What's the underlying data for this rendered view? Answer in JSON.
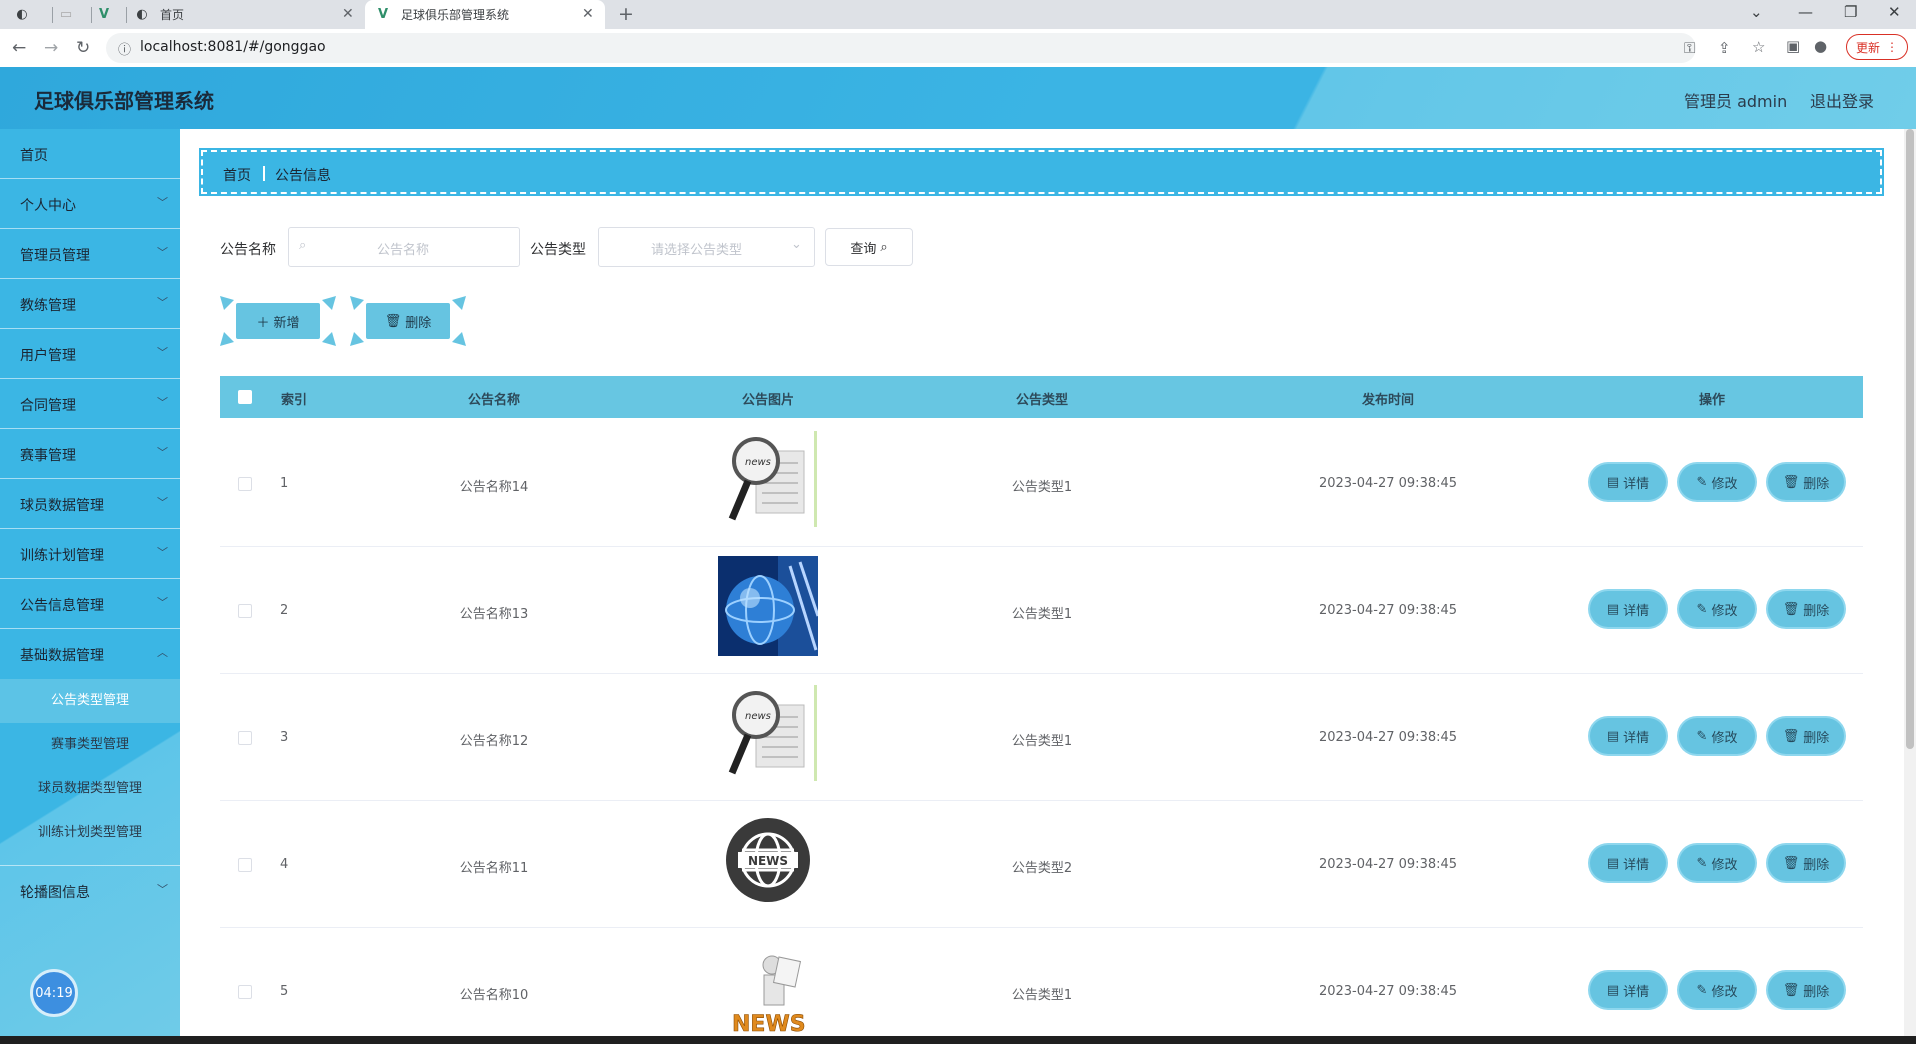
{
  "browser": {
    "tabs": [
      {
        "label": "首页"
      },
      {
        "label": "足球俱乐部管理系统"
      }
    ],
    "url": "localhost:8081/#/gonggao",
    "update_label": "更新"
  },
  "header": {
    "title": "足球俱乐部管理系统",
    "user": "管理员 admin",
    "logout": "退出登录"
  },
  "sidebar": {
    "items": [
      {
        "label": "首页"
      },
      {
        "label": "个人中心"
      },
      {
        "label": "管理员管理"
      },
      {
        "label": "教练管理"
      },
      {
        "label": "用户管理"
      },
      {
        "label": "合同管理"
      },
      {
        "label": "赛事管理"
      },
      {
        "label": "球员数据管理"
      },
      {
        "label": "训练计划管理"
      },
      {
        "label": "公告信息管理"
      },
      {
        "label": "基础数据管理"
      },
      {
        "label": "轮播图信息"
      }
    ],
    "sub_items": [
      {
        "label": "公告类型管理"
      },
      {
        "label": "赛事类型管理"
      },
      {
        "label": "球员数据类型管理"
      },
      {
        "label": "训练计划类型管理"
      }
    ],
    "clock": "04:19"
  },
  "breadcrumb": {
    "home": "首页",
    "current": "公告信息"
  },
  "filters": {
    "name_label": "公告名称",
    "name_placeholder": "公告名称",
    "type_label": "公告类型",
    "type_placeholder": "请选择公告类型",
    "query_label": "查询"
  },
  "actions": {
    "add_label": "新增",
    "delete_label": "删除"
  },
  "table": {
    "columns": [
      "索引",
      "公告名称",
      "公告图片",
      "公告类型",
      "发布时间",
      "操作"
    ],
    "row_buttons": {
      "detail": "详情",
      "edit": "修改",
      "delete": "删除"
    },
    "rows": [
      {
        "index": "1",
        "name": "公告名称14",
        "image": "news-magnifier-icon",
        "type": "公告类型1",
        "time": "2023-04-27 09:38:45"
      },
      {
        "index": "2",
        "name": "公告名称13",
        "image": "globe-news-icon",
        "type": "公告类型1",
        "time": "2023-04-27 09:38:45"
      },
      {
        "index": "3",
        "name": "公告名称12",
        "image": "news-magnifier-icon",
        "type": "公告类型1",
        "time": "2023-04-27 09:38:45"
      },
      {
        "index": "4",
        "name": "公告名称11",
        "image": "news-globe-badge-icon",
        "type": "公告类型2",
        "time": "2023-04-27 09:38:45"
      },
      {
        "index": "5",
        "name": "公告名称10",
        "image": "news-figure-icon",
        "type": "公告类型1",
        "time": "2023-04-27 09:38:45"
      }
    ]
  },
  "colors": {
    "accent": "#3bb6e4",
    "button": "#66c4e1",
    "table_header": "#67c6e2"
  }
}
